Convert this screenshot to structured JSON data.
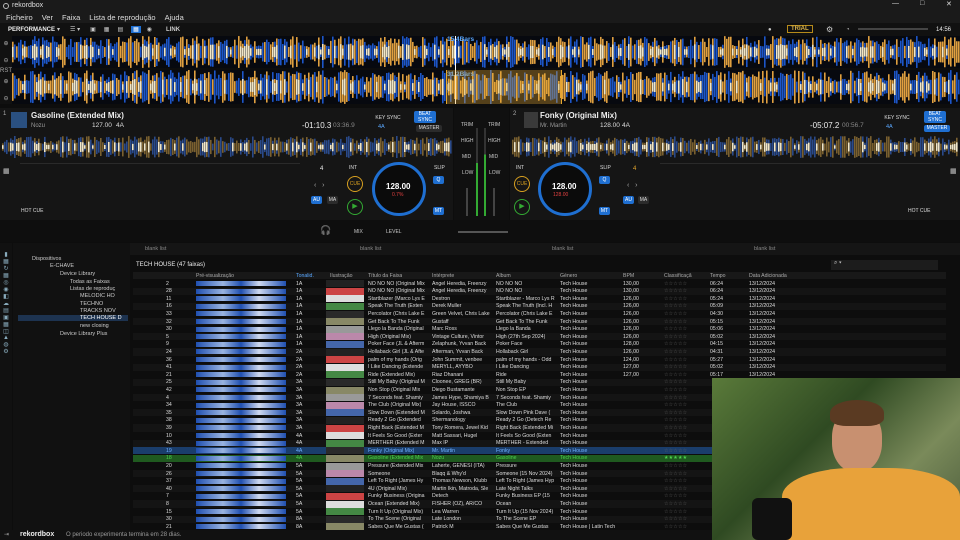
{
  "app": {
    "title": "rekordbox",
    "trial": "TRIAL",
    "clock": "14:56",
    "mode": "PERFORMANCE",
    "link": "LINK",
    "footer_msg": "O periodo experimenta termina em 28 dias.",
    "footer_brand": "rekordbox"
  },
  "menu": [
    "Ficheiro",
    "Ver",
    "Faixa",
    "Lista de reprodução",
    "Ajuda"
  ],
  "waveform": {
    "top_label": "15.4Bars",
    "bottom_label": "31.2Bars"
  },
  "deck1": {
    "title": "Gasoline (Extended Mix)",
    "artist": "Nozu",
    "bpm": "127.00",
    "key": "4A",
    "remain": "-01:10.3",
    "elapsed": "03:36.9",
    "key_sync": "KEY SYNC",
    "beat_sync": "BEAT SYNC",
    "master": "MASTER",
    "jog_bpm": "128.00",
    "jog_pitch": "0.7%",
    "jog_sub": "±6",
    "hot_cue": "HOT CUE",
    "cue": "CUE",
    "int": "INT",
    "slip": "SLIP",
    "au": "AU",
    "ma": "MA",
    "q": "Q",
    "mt": "MT",
    "quant": "4",
    "deck_num": "1"
  },
  "deck2": {
    "title": "Fonky (Original Mix)",
    "artist": "Mr. Martin",
    "bpm": "128.00",
    "key": "4A",
    "remain": "-05:07.2",
    "elapsed": "00:56.7",
    "key_sync": "KEY SYNC",
    "beat_sync": "BEAT SYNC",
    "master": "MASTER",
    "jog_bpm": "128.00",
    "jog_pitch": "128.00",
    "jog_sub": "±6",
    "hot_cue": "HOT CUE",
    "cue": "CUE",
    "int": "INT",
    "slip": "SLIP",
    "au": "AU",
    "ma": "MA",
    "q": "Q",
    "mt": "MT",
    "quant": "4",
    "deck_num": "2"
  },
  "mixer": {
    "trim": "TRIM",
    "high": "HIGH",
    "mid": "MID",
    "low": "LOW",
    "mix": "MIX",
    "level": "LEVEL"
  },
  "browser": {
    "tabs": [
      "blank list",
      "blank list",
      "blank list",
      "blank list"
    ],
    "list_title": "TECH HOUSE (47 faixas)",
    "search_placeholder": ""
  },
  "tree": [
    "Dispositivos",
    "E-CHAVE",
    "Device Library",
    "Todas as Faixas",
    "Listas de reproduç",
    "MELODIC HO",
    "TECHNO",
    "TRACKS NOV",
    "TECH HOUSE D",
    "new closing",
    "Device Library Plus"
  ],
  "columns": [
    "Pré-visualização",
    "Tonalid.",
    "Ilustração",
    "Título da Faixa",
    "Intérprete",
    "Álbum",
    "Género",
    "BPM",
    "Classificaçã",
    "Tempo",
    "Data Adicionada"
  ],
  "rows": [
    {
      "n": "2",
      "k": "1A",
      "t": "NO NO NO (Original Mix",
      "a": "Angel Heredia, Freenzy",
      "al": "NO NO NO",
      "g": "Tech House",
      "b": "130,00",
      "tm": "06:24",
      "d": "13/12/2024"
    },
    {
      "n": "28",
      "k": "1A",
      "t": "NO NO NO (Original Mix",
      "a": "Angel Heredia, Freenzy",
      "al": "NO NO NO",
      "g": "Tech House",
      "b": "130,00",
      "tm": "06:24",
      "d": "13/12/2024"
    },
    {
      "n": "11",
      "k": "1A",
      "t": "Startblazer (Marco Lys E",
      "a": "Destron",
      "al": "Startblazer - Marco Lys R",
      "g": "Tech House",
      "b": "126,00",
      "tm": "05:24",
      "d": "13/12/2024"
    },
    {
      "n": "16",
      "k": "1A",
      "t": "Speak The Truth (Exten",
      "a": "Derek Muller",
      "al": "Speak The Truth (Incl. H",
      "g": "Tech House",
      "b": "126,00",
      "tm": "05:09",
      "d": "13/12/2024"
    },
    {
      "n": "33",
      "k": "1A",
      "t": "Percolator (Chris Lake E",
      "a": "Green Velvet, Chris Lake",
      "al": "Percolator (Chris Lake E",
      "g": "Tech House",
      "b": "126,00",
      "tm": "04:30",
      "d": "13/12/2024"
    },
    {
      "n": "32",
      "k": "1A",
      "t": "Get Back To The Funk",
      "a": "Gustaff",
      "al": "Get Back To The Funk",
      "g": "Tech House",
      "b": "126,00",
      "tm": "05:15",
      "d": "13/12/2024"
    },
    {
      "n": "30",
      "k": "1A",
      "t": "Llego la Banda (Original",
      "a": "Marc Ross",
      "al": "Llego la Banda",
      "g": "Tech House",
      "b": "126,00",
      "tm": "05:06",
      "d": "13/12/2024"
    },
    {
      "n": "5",
      "k": "1A",
      "t": "High (Original Mix)",
      "a": "Vintage Culture, Vintor",
      "al": "High (27th Sep 2024)",
      "g": "Tech House",
      "b": "126,00",
      "tm": "05:02",
      "d": "13/12/2024"
    },
    {
      "n": "9",
      "k": "1A",
      "t": "Poker Face (JL & Afterm",
      "a": "Zelaphunk, Yvvan Back",
      "al": "Poker Face",
      "g": "Tech House",
      "b": "128,00",
      "tm": "04:15",
      "d": "13/12/2024"
    },
    {
      "n": "24",
      "k": "2A",
      "t": "Hollaback Girl (JL & Afte",
      "a": "Afterman, Yvvan Back",
      "al": "Hollaback Girl",
      "g": "Tech House",
      "b": "126,00",
      "tm": "04:31",
      "d": "13/12/2024"
    },
    {
      "n": "36",
      "k": "2A",
      "t": "palm of my hands (Orig",
      "a": "John Summit, venbee",
      "al": "palm of my hands - Odd",
      "g": "Tech House",
      "b": "124,00",
      "tm": "05:27",
      "d": "13/12/2024"
    },
    {
      "n": "41",
      "k": "2A",
      "t": "I Like Dancing (Extende",
      "a": "MERYLL, AYYBO",
      "al": "I Like Dancing",
      "g": "Tech House",
      "b": "127,00",
      "tm": "05:02",
      "d": "13/12/2024"
    },
    {
      "n": "21",
      "k": "2A",
      "t": "Ride (Extended Mix)",
      "a": "Riaz Dhanani",
      "al": "Ride",
      "g": "Tech House",
      "b": "127,00",
      "tm": "05:17",
      "d": "13/12/2024"
    },
    {
      "n": "25",
      "k": "3A",
      "t": "Still My Baby (Original M",
      "a": "Cloonee, GREG (BR)",
      "al": "Still My Baby",
      "g": "Tech House",
      "b": "",
      "tm": "",
      "d": ""
    },
    {
      "n": "42",
      "k": "3A",
      "t": "Non Stop (Original Mix",
      "a": "Diego Bustamante",
      "al": "Non Stop EP",
      "g": "Tech House",
      "b": "",
      "tm": "",
      "d": ""
    },
    {
      "n": "4",
      "k": "3A",
      "t": "7 Seconds feat. Shamiy",
      "a": "James Hype, Shamiya B",
      "al": "7 Seconds feat. Shamiy",
      "g": "Tech House",
      "b": "",
      "tm": "",
      "d": ""
    },
    {
      "n": "34",
      "k": "3A",
      "t": "The Club (Original Mix)",
      "a": "Jay House, ISSCO",
      "al": "The Club",
      "g": "Tech House",
      "b": "",
      "tm": "",
      "d": ""
    },
    {
      "n": "35",
      "k": "3A",
      "t": "Slow Down (Extended M",
      "a": "Solardo, Joshwa",
      "al": "Slow Down Pink Dave (",
      "g": "Tech House",
      "b": "",
      "tm": "",
      "d": ""
    },
    {
      "n": "38",
      "k": "3A",
      "t": "Ready 2 Go (Extended",
      "a": "Shermanology",
      "al": "Ready 2 Go (Detech Re",
      "g": "Tech House",
      "b": "",
      "tm": "",
      "d": ""
    },
    {
      "n": "39",
      "k": "3A",
      "t": "Right Back (Extended M",
      "a": "Tony Romera, Jewel Kid",
      "al": "Right Back (Extended Mi",
      "g": "Tech House",
      "b": "",
      "tm": "",
      "d": ""
    },
    {
      "n": "10",
      "k": "4A",
      "t": "It Feels So Good (Exter",
      "a": "Matt Sassari, Hugel",
      "al": "It Feels So Good (Exten",
      "g": "Tech House",
      "b": "",
      "tm": "",
      "d": ""
    },
    {
      "n": "43",
      "k": "4A",
      "t": "MERTHER (Extended M",
      "a": "Max IP",
      "al": "MERTHER - Extended",
      "g": "Tech House",
      "b": "",
      "tm": "",
      "d": ""
    },
    {
      "n": "19",
      "k": "4A",
      "t": "Fonky (Original Mix)",
      "a": "Mr. Martin",
      "al": "Fonky",
      "g": "Tech House",
      "b": "",
      "tm": "",
      "d": "",
      "sel": "blue"
    },
    {
      "n": "18",
      "k": "4A",
      "t": "Gasoline (Extended Mix",
      "a": "Nozu",
      "al": "Gasoline",
      "g": "Tech House",
      "b": "",
      "tm": "",
      "d": "",
      "sel": "green"
    },
    {
      "n": "20",
      "k": "5A",
      "t": "Pressure (Extended Mix",
      "a": "Laherte, GENESI (ITA)",
      "al": "Pressure",
      "g": "Tech House",
      "b": "",
      "tm": "",
      "d": ""
    },
    {
      "n": "26",
      "k": "5A",
      "t": "Someone",
      "a": "Blaqq & Why'd",
      "al": "Someone (15 Nov 2024)",
      "g": "Tech House",
      "b": "",
      "tm": "",
      "d": ""
    },
    {
      "n": "37",
      "k": "5A",
      "t": "Left To Right (James Hy",
      "a": "Thomas Newson, Klubb",
      "al": "Left To Right (James Hyp",
      "g": "Tech House",
      "b": "",
      "tm": "",
      "d": ""
    },
    {
      "n": "40",
      "k": "5A",
      "t": "4U (Original Mix)",
      "a": "Martin Ikin, Matroda, Sle",
      "al": "Late Night Talks",
      "g": "Tech House",
      "b": "",
      "tm": "",
      "d": ""
    },
    {
      "n": "7",
      "k": "5A",
      "t": "Funky Business (Origina",
      "a": "Detech",
      "al": "Funky Business EP (15",
      "g": "Tech House",
      "b": "",
      "tm": "",
      "d": ""
    },
    {
      "n": "8",
      "k": "5A",
      "t": "Ocean (Extended Mix)",
      "a": "FISHER (OZ), AR/CO",
      "al": "Ocean",
      "g": "Tech House",
      "b": "",
      "tm": "",
      "d": ""
    },
    {
      "n": "15",
      "k": "5A",
      "t": "Turn It Up (Original Mix)",
      "a": "Lea Warren",
      "al": "Turn It Up (15 Nov 2024)",
      "g": "Tech House",
      "b": "",
      "tm": "",
      "d": ""
    },
    {
      "n": "30",
      "k": "8A",
      "t": "To The Scene (Original",
      "a": "Late London",
      "al": "To The Scene EP",
      "g": "Tech House",
      "b": "",
      "tm": "",
      "d": ""
    },
    {
      "n": "21",
      "k": "8A",
      "t": "Sabes Que Me Gustas (",
      "a": "Patrick M",
      "al": "Sabes Que Me Gustas",
      "g": "Tech House | Latin Tech",
      "b": "",
      "tm": "",
      "d": ""
    }
  ],
  "colors": {
    "accent": "#1f6fd1",
    "selected_blue": "#1a3d6b",
    "selected_green": "#1f5a1f",
    "green_text": "#4cd34c"
  }
}
